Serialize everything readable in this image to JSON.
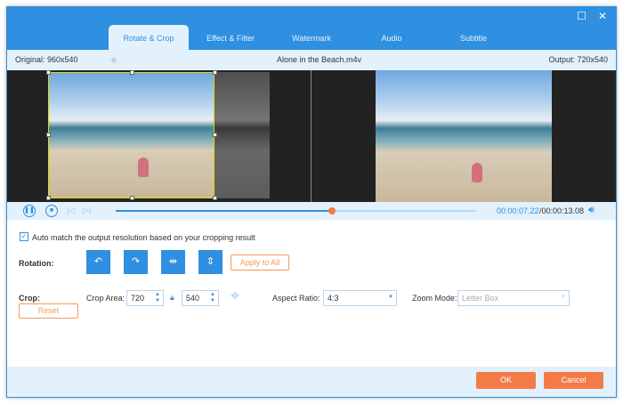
{
  "tabs": [
    "Rotate & Crop",
    "Effect & Filter",
    "Watermark",
    "Audio",
    "Subtitle"
  ],
  "active_tab": "Rotate & Crop",
  "info": {
    "original": "Original: 960x540",
    "filename": "Alone in the Beach.m4v",
    "output": "Output: 720x540"
  },
  "player": {
    "current_time": "00:00:07.22",
    "total_time": "/00:00:13.08",
    "progress": 0.6
  },
  "auto_match": {
    "checked": true,
    "label": "Auto match the output resolution based on your cropping result"
  },
  "rotation": {
    "label": "Rotation:",
    "apply_all": "Apply to All"
  },
  "crop": {
    "label": "Crop:",
    "area_label": "Crop Area:",
    "width": "720",
    "height": "540",
    "aspect_label": "Aspect Ratio:",
    "aspect_value": "4:3",
    "zoom_label": "Zoom Mode:",
    "zoom_value": "Letter Box",
    "reset": "Reset"
  },
  "footer": {
    "ok": "OK",
    "cancel": "Cancel"
  },
  "colors": {
    "accent": "#2f8fe0",
    "orange": "#f37b47"
  }
}
